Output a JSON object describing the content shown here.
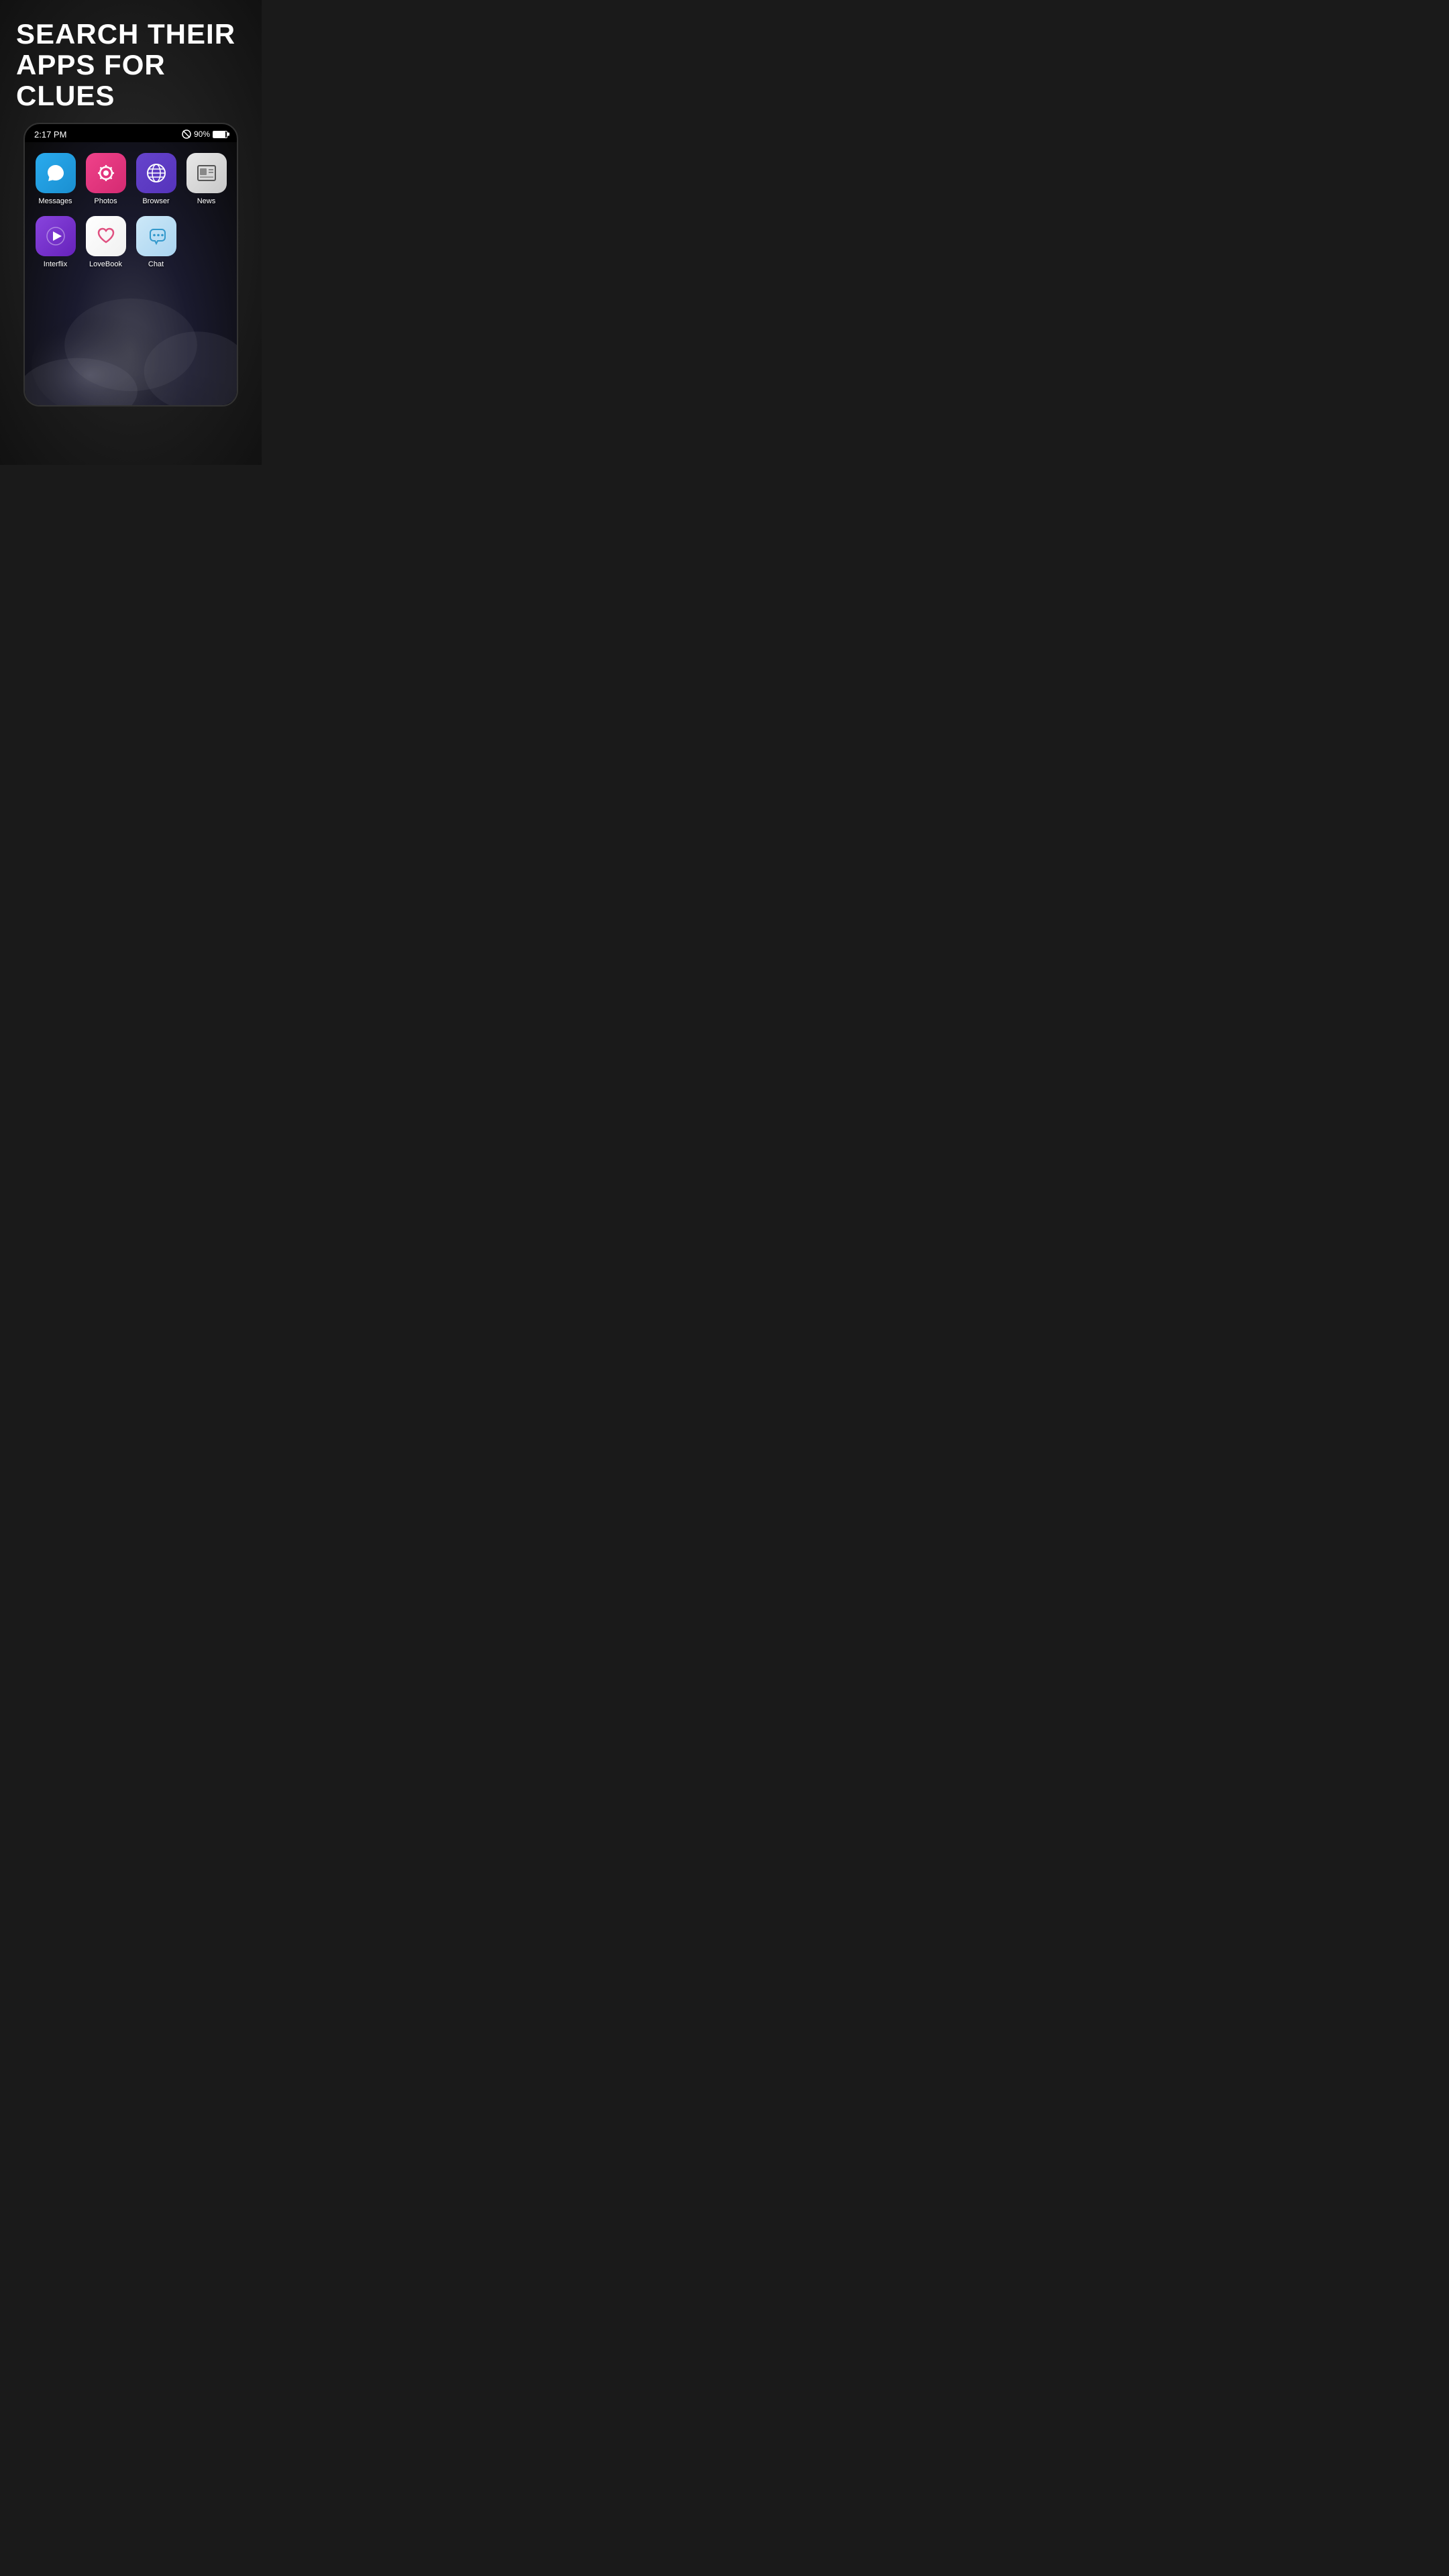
{
  "headline": {
    "line1": "SEARCH THEIR",
    "line2": "APPS FOR CLUES"
  },
  "status_bar": {
    "time": "2:17 PM",
    "battery_pct": "90%"
  },
  "apps_row1": [
    {
      "id": "messages",
      "label": "Messages",
      "icon_type": "messages"
    },
    {
      "id": "photos",
      "label": "Photos",
      "icon_type": "photos"
    },
    {
      "id": "browser",
      "label": "Browser",
      "icon_type": "browser"
    },
    {
      "id": "news",
      "label": "News",
      "icon_type": "news"
    }
  ],
  "apps_row2": [
    {
      "id": "interflix",
      "label": "Interflix",
      "icon_type": "interflix"
    },
    {
      "id": "lovebook",
      "label": "LoveBook",
      "icon_type": "lovebook"
    },
    {
      "id": "chat",
      "label": "Chat",
      "icon_type": "chat"
    }
  ]
}
